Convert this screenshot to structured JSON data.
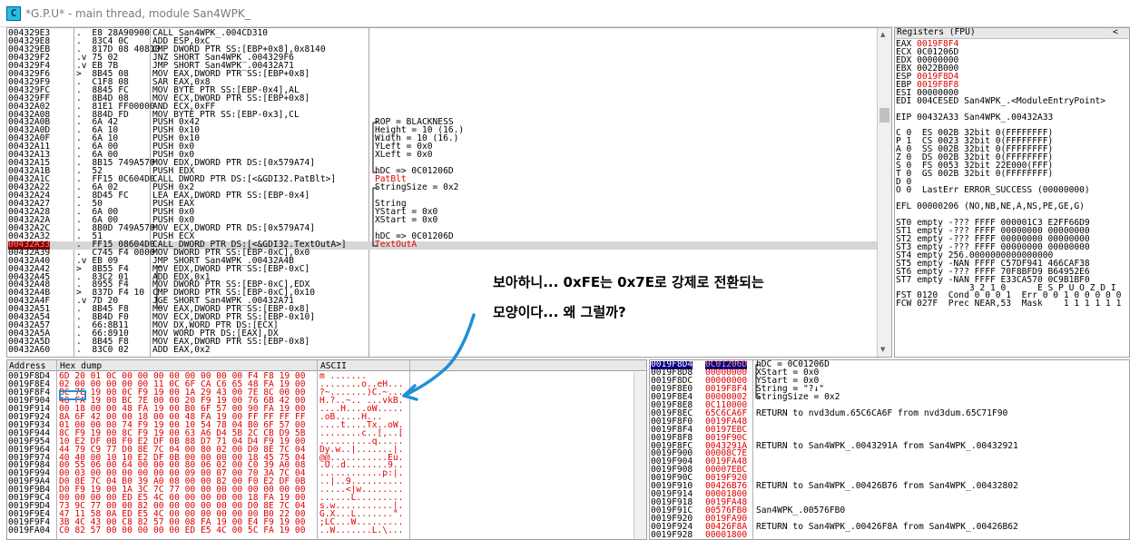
{
  "window": {
    "icon_text": "C",
    "title": "*G.P.U* - main thread, module San4WPK_"
  },
  "cpu": {
    "rows": [
      {
        "addr": "004329E3",
        "bytes": ".  E8 28A90900",
        "dis": "CALL San4WPK_.004CD310",
        "com": ""
      },
      {
        "addr": "004329E8",
        "bytes": ".  83C4 0C",
        "dis": "ADD ESP,0xC",
        "com": ""
      },
      {
        "addr": "004329EB",
        "bytes": ".  817D 08 40810",
        "dis": "CMP DWORD PTR SS:[EBP+0x8],0x8140",
        "com": ""
      },
      {
        "addr": "004329F2",
        "bytes": ".v 75 02",
        "dis": "JNZ SHORT San4WPK_.004329F6",
        "com": ""
      },
      {
        "addr": "004329F4",
        "bytes": ".v EB 7B",
        "dis": "JMP SHORT San4WPK_.00432A71",
        "com": ""
      },
      {
        "addr": "004329F6",
        "bytes": ">  8B45 08",
        "dis": "MOV EAX,DWORD PTR SS:[EBP+0x8]",
        "com": ""
      },
      {
        "addr": "004329F9",
        "bytes": ".  C1F8 08",
        "dis": "SAR EAX,0x8",
        "com": ""
      },
      {
        "addr": "004329FC",
        "bytes": ".  8845 FC",
        "dis": "MOV BYTE PTR SS:[EBP-0x4],AL",
        "com": ""
      },
      {
        "addr": "004329FF",
        "bytes": ".  8B4D 08",
        "dis": "MOV ECX,DWORD PTR SS:[EBP+0x8]",
        "com": ""
      },
      {
        "addr": "00432A02",
        "bytes": ".  81E1 FF00000",
        "dis": "AND ECX,0xFF",
        "com": ""
      },
      {
        "addr": "00432A08",
        "bytes": ".  884D FD",
        "dis": "MOV BYTE PTR SS:[EBP-0x3],CL",
        "com": ""
      },
      {
        "addr": "00432A0B",
        "bytes": ".  6A 42",
        "dis": "PUSH 0x42",
        "com": "ROP = BLACKNESS"
      },
      {
        "addr": "00432A0D",
        "bytes": ".  6A 10",
        "dis": "PUSH 0x10",
        "com": "Height = 10 (16.)"
      },
      {
        "addr": "00432A0F",
        "bytes": ".  6A 10",
        "dis": "PUSH 0x10",
        "com": "Width = 10 (16.)"
      },
      {
        "addr": "00432A11",
        "bytes": ".  6A 00",
        "dis": "PUSH 0x0",
        "com": "YLeft = 0x0"
      },
      {
        "addr": "00432A13",
        "bytes": ".  6A 00",
        "dis": "PUSH 0x0",
        "com": "XLeft = 0x0"
      },
      {
        "addr": "00432A15",
        "bytes": ".  8B15 749A570",
        "dis": "MOV EDX,DWORD PTR DS:[0x579A74]",
        "com": ""
      },
      {
        "addr": "00432A1B",
        "bytes": ".  52",
        "dis": "PUSH EDX",
        "com": "hDC => 0C01206D"
      },
      {
        "addr": "00432A1C",
        "bytes": ".  FF15 0C604D0",
        "dis": "CALL DWORD PTR DS:[<&GDI32.PatBlt>]",
        "com": "PatBlt",
        "com_red": true
      },
      {
        "addr": "00432A22",
        "bytes": ".  6A 02",
        "dis": "PUSH 0x2",
        "com": "StringSize = 0x2"
      },
      {
        "addr": "00432A24",
        "bytes": ".  8D45 FC",
        "dis": "LEA EAX,DWORD PTR SS:[EBP-0x4]",
        "com": ""
      },
      {
        "addr": "00432A27",
        "bytes": ".  50",
        "dis": "PUSH EAX",
        "com": "String"
      },
      {
        "addr": "00432A28",
        "bytes": ".  6A 00",
        "dis": "PUSH 0x0",
        "com": "YStart = 0x0"
      },
      {
        "addr": "00432A2A",
        "bytes": ".  6A 00",
        "dis": "PUSH 0x0",
        "com": "XStart = 0x0"
      },
      {
        "addr": "00432A2C",
        "bytes": ".  8B0D 749A570",
        "dis": "MOV ECX,DWORD PTR DS:[0x579A74]",
        "com": ""
      },
      {
        "addr": "00432A32",
        "bytes": ".  51",
        "dis": "PUSH ECX",
        "com": "hDC => 0C01206D"
      },
      {
        "addr": "00432A33",
        "bytes": ".  FF15 08604D0",
        "dis": "CALL DWORD PTR DS:[<&GDI32.TextOutA>]",
        "com": "TextOutA",
        "com_red": true,
        "current": true
      },
      {
        "addr": "00432A39",
        "bytes": ".  C745 F4 0000",
        "dis": "MOV DWORD PTR SS:[EBP-0xC],0x0",
        "com": ""
      },
      {
        "addr": "00432A40",
        "bytes": ".v EB 09",
        "dis": "JMP SHORT San4WPK_.00432A4B",
        "com": ""
      },
      {
        "addr": "00432A42",
        "bytes": ">  8B55 F4",
        "dis": "MOV EDX,DWORD PTR SS:[EBP-0xC]",
        "com": ""
      },
      {
        "addr": "00432A45",
        "bytes": ".  83C2 01",
        "dis": "ADD EDX,0x1",
        "com": ""
      },
      {
        "addr": "00432A48",
        "bytes": ".  8955 F4",
        "dis": "MOV DWORD PTR SS:[EBP-0xC],EDX",
        "com": ""
      },
      {
        "addr": "00432A4B",
        "bytes": ">  837D F4 10",
        "dis": "CMP DWORD PTR SS:[EBP-0xC],0x10",
        "com": ""
      },
      {
        "addr": "00432A4F",
        "bytes": ".v 7D 20",
        "dis": "JGE SHORT San4WPK_.00432A71",
        "com": ""
      },
      {
        "addr": "00432A51",
        "bytes": ".  8B45 F8",
        "dis": "MOV EAX,DWORD PTR SS:[EBP-0x8]",
        "com": ""
      },
      {
        "addr": "00432A54",
        "bytes": ".  8B4D F0",
        "dis": "MOV ECX,DWORD PTR SS:[EBP-0x10]",
        "com": ""
      },
      {
        "addr": "00432A57",
        "bytes": ".  66:8B11",
        "dis": "MOV DX,WORD PTR DS:[ECX]",
        "com": ""
      },
      {
        "addr": "00432A5A",
        "bytes": ".  66:8910",
        "dis": "MOV WORD PTR DS:[EAX],DX",
        "com": ""
      },
      {
        "addr": "00432A5D",
        "bytes": ".  8B45 F8",
        "dis": "MOV EAX,DWORD PTR SS:[EBP-0x8]",
        "com": ""
      },
      {
        "addr": "00432A60",
        "bytes": ".  83C0 02",
        "dis": "ADD EAX,0x2",
        "com": ""
      }
    ]
  },
  "registers": {
    "header": "Registers (FPU)",
    "collapse_glyph": "<",
    "lines": [
      {
        "t": "EAX ",
        "v": "0019F8F4",
        "red": true,
        "r": ""
      },
      {
        "t": "ECX 0C01206D",
        "v": "",
        "red": false,
        "r": ""
      },
      {
        "t": "EDX 00000000",
        "v": "",
        "red": false,
        "r": ""
      },
      {
        "t": "EBX 0022B000",
        "v": "",
        "red": false,
        "r": ""
      },
      {
        "t": "ESP ",
        "v": "0019F8D4",
        "red": true,
        "r": ""
      },
      {
        "t": "EBP ",
        "v": "0019F8F8",
        "red": true,
        "r": ""
      },
      {
        "t": "ESI 00000000",
        "v": "",
        "red": false,
        "r": ""
      },
      {
        "t": "EDI 004CESED San4WPK_.<ModuleEntryPoint>",
        "v": "",
        "red": false,
        "r": ""
      },
      {
        "t": "",
        "v": "",
        "red": false,
        "r": ""
      },
      {
        "t": "EIP 00432A33 San4WPK_.00432A33",
        "v": "",
        "red": false,
        "r": ""
      },
      {
        "t": "",
        "v": "",
        "red": false,
        "r": ""
      },
      {
        "t": "C 0  ES 002B 32bit 0(FFFFFFFF)",
        "v": "",
        "red": false,
        "r": ""
      },
      {
        "t": "P 1  CS 0023 32bit 0(FFFFFFFF)",
        "v": "",
        "red": false,
        "r": ""
      },
      {
        "t": "A 0  SS 002B 32bit 0(FFFFFFFF)",
        "v": "",
        "red": false,
        "r": ""
      },
      {
        "t": "Z 0  DS 002B 32bit 0(FFFFFFFF)",
        "v": "",
        "red": false,
        "r": ""
      },
      {
        "t": "S 0  FS 0053 32bit 22E000(FFF)",
        "v": "",
        "red": false,
        "r": ""
      },
      {
        "t": "T 0  GS 002B 32bit 0(FFFFFFFF)",
        "v": "",
        "red": false,
        "r": ""
      },
      {
        "t": "D 0",
        "v": "",
        "red": false,
        "r": ""
      },
      {
        "t": "O 0  LastErr ERROR_SUCCESS (00000000)",
        "v": "",
        "red": false,
        "r": ""
      },
      {
        "t": "",
        "v": "",
        "red": false,
        "r": ""
      },
      {
        "t": "EFL 00000206 (NO,NB,NE,A,NS,PE,GE,G)",
        "v": "",
        "red": false,
        "r": ""
      },
      {
        "t": "",
        "v": "",
        "red": false,
        "r": ""
      },
      {
        "t": "ST0 empty -??? FFFF 000001C3 E2FF66D9",
        "v": "",
        "red": false,
        "r": ""
      },
      {
        "t": "ST1 empty -??? FFFF 00000000 00000000",
        "v": "",
        "red": false,
        "r": ""
      },
      {
        "t": "ST2 empty -??? FFFF 00000000 00000000",
        "v": "",
        "red": false,
        "r": ""
      },
      {
        "t": "ST3 empty -??? FFFF 00000000 00000000",
        "v": "",
        "red": false,
        "r": ""
      },
      {
        "t": "ST4 empty 256.0000000000000000",
        "v": "",
        "red": false,
        "r": ""
      },
      {
        "t": "ST5 empty -NAN FFFF C57DF941 466CAF38",
        "v": "",
        "red": false,
        "r": ""
      },
      {
        "t": "ST6 empty -??? FFFF 70F8BFD9 B64952E6",
        "v": "",
        "red": false,
        "r": ""
      },
      {
        "t": "ST7 empty -NAN FFFF E33CA570 0C9B1BF0",
        "v": "",
        "red": false,
        "r": ""
      },
      {
        "t": "              3 2 1 0      E S P U O Z D I",
        "v": "",
        "red": false,
        "r": ""
      },
      {
        "t": "FST 0120  Cond 0 0 0 1  Err 0 0 1 0 0 0 0 0",
        "v": "",
        "red": false,
        "r": ""
      },
      {
        "t": "FCW 027F  Prec NEAR,53  Mask    1 1 1 1 1 1",
        "v": "",
        "red": false,
        "r": ""
      }
    ]
  },
  "dump": {
    "col_address": "Address",
    "col_hex": "Hex dump",
    "col_ascii": "ASCII",
    "rows": [
      {
        "addr": "0019F8D4",
        "hex": "6D 20 01 0C 00 00 00 00 00 00 00 00 F4 F8 19 00",
        "asc": "m ......."
      },
      {
        "addr": "0019F8E4",
        "hex": "02 00 00 00 00 00 11 0C 6F CA C6 65 48 FA 19 00",
        "asc": "........o..eH..."
      },
      {
        "addr": "0019F8F4",
        "hex": "BC 7E 19 00 0C F9 19 00 1A 29 43 00 7E 8C 00 00",
        "asc": "?~.......)C.~..."
      },
      {
        "addr": "0019F904",
        "hex": "48 FA 19 00 BC 7E 00 00 20 F9 19 00 76 6B 42 00",
        "asc": "H.?..~.. ...vkB."
      },
      {
        "addr": "0019F914",
        "hex": "00 18 00 00 48 FA 19 00 B0 6F 57 00 90 FA 19 00",
        "asc": "....H....oW....."
      },
      {
        "addr": "0019F924",
        "hex": "8A 6F 42 00 00 18 00 00 48 FA 19 00 FF FF FF FF",
        "asc": ".oB.....H..."
      },
      {
        "addr": "0019F934",
        "hex": "01 00 00 00 74 F9 19 00 10 54 78 04 B0 6F 57 00",
        "asc": "....t....Tx..oW."
      },
      {
        "addr": "0019F944",
        "hex": "8C F9 19 00 8C F9 19 00 63 A6 D4 5B 2C CB D9 5B",
        "asc": "........c..[,..["
      },
      {
        "addr": "0019F954",
        "hex": "10 E2 DF 0B F0 E2 DF 0B 88 D7 71 04 D4 F9 19 00",
        "asc": "..........q....."
      },
      {
        "addr": "0019F964",
        "hex": "44 79 C9 77 D0 8E 7C 04 00 80 02 00 D0 8E 7C 04",
        "asc": "Dy.w..|.......|."
      },
      {
        "addr": "0019F974",
        "hex": "40 40 00 10 10 E2 DF 0B 00 00 00 00 18 45 75 04",
        "asc": "@@...........Eu."
      },
      {
        "addr": "0019F984",
        "hex": "00 55 06 00 64 00 00 00 80 06 02 00 C0 39 A0 08",
        "asc": ".U..d........9.."
      },
      {
        "addr": "0019F994",
        "hex": "00 03 00 00 00 00 00 00 09 00 07 00 70 3A 7C 04",
        "asc": "............p:|."
      },
      {
        "addr": "0019F9A4",
        "hex": "D0 8E 7C 04 B0 39 A0 08 00 00 82 00 F0 E2 DF 0B",
        "asc": "..|..9.........."
      },
      {
        "addr": "0019F9B4",
        "hex": "D0 F9 19 00 1A 3C 7C 77 00 00 00 00 00 00 00 00",
        "asc": ".....<|w........"
      },
      {
        "addr": "0019F9C4",
        "hex": "00 00 00 00 ED E5 4C 00 00 00 00 00 18 FA 19 00",
        "asc": "......L........."
      },
      {
        "addr": "0019F9D4",
        "hex": "73 9C 77 00 00 82 00 00 00 00 00 00 D0 8E 7C 04",
        "asc": "s.w...........|."
      },
      {
        "addr": "0019F9E4",
        "hex": "47 11 58 0A ED E5 4C 00 00 00 00 00 00 B0 22 00",
        "asc": "G.X...L.......\"."
      },
      {
        "addr": "0019F9F4",
        "hex": "3B 4C 43 00 C8 82 57 00 08 FA 19 00 E4 F9 19 00",
        "asc": ";LC...W........."
      },
      {
        "addr": "0019FA04",
        "hex": "C0 82 57 00 00 00 00 00 ED E5 4C 00 5C FA 19 00",
        "asc": "..W.......L.\\..."
      }
    ]
  },
  "stack": {
    "rows": [
      {
        "addr": "0019F8D4",
        "val": "0C01206D",
        "com": "hDC = 0C01206D",
        "top": true
      },
      {
        "addr": "0019F8D8",
        "val": "00000000",
        "com": "XStart = 0x0"
      },
      {
        "addr": "0019F8DC",
        "val": "00000000",
        "com": "YStart = 0x0"
      },
      {
        "addr": "0019F8E0",
        "val": "0019F8F4",
        "com": "String = \"?↓\""
      },
      {
        "addr": "0019F8E4",
        "val": "00000002",
        "com": "StringSize = 0x2"
      },
      {
        "addr": "0019F8E8",
        "val": "0C110000",
        "com": ""
      },
      {
        "addr": "0019F8EC",
        "val": "65C6CA6F",
        "com": "RETURN to nvd3dum.65C6CA6F from nvd3dum.65C71F90"
      },
      {
        "addr": "0019F8F0",
        "val": "0019FA48",
        "com": ""
      },
      {
        "addr": "0019F8F4",
        "val": "00197EBC",
        "com": ""
      },
      {
        "addr": "0019F8F8",
        "val": "0019F90C",
        "com": ""
      },
      {
        "addr": "0019F8FC",
        "val": "0043291A",
        "com": "RETURN to San4WPK_.0043291A from San4WPK_.00432921"
      },
      {
        "addr": "0019F900",
        "val": "00008C7E",
        "com": ""
      },
      {
        "addr": "0019F904",
        "val": "0019FA48",
        "com": ""
      },
      {
        "addr": "0019F908",
        "val": "00007EBC",
        "com": ""
      },
      {
        "addr": "0019F90C",
        "val": "0019F920",
        "com": ""
      },
      {
        "addr": "0019F910",
        "val": "00426B76",
        "com": "RETURN to San4WPK_.00426B76 from San4WPK_.00432802"
      },
      {
        "addr": "0019F914",
        "val": "00001800",
        "com": ""
      },
      {
        "addr": "0019F918",
        "val": "0019FA48",
        "com": ""
      },
      {
        "addr": "0019F91C",
        "val": "00576FB0",
        "com": "San4WPK_.00576FB0"
      },
      {
        "addr": "0019F920",
        "val": "0019FA90",
        "com": ""
      },
      {
        "addr": "0019F924",
        "val": "00426F8A",
        "com": "RETURN to San4WPK_.00426F8A from San4WPK_.00426B62"
      },
      {
        "addr": "0019F928",
        "val": "00001800",
        "com": ""
      }
    ]
  },
  "annotation": {
    "line1": "보아하니... 0xFE는 0x7E로 강제로 전환되는",
    "line2": "모양이다... 왜 그럴까?"
  }
}
